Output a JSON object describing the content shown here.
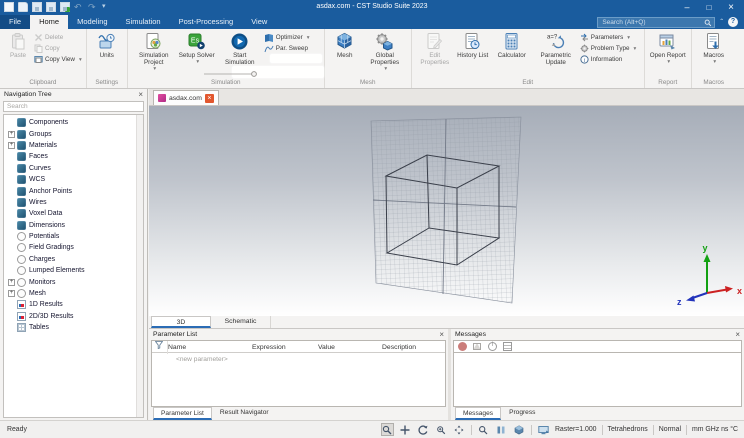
{
  "title_bar": {
    "title": "asdax.com - CST Studio Suite 2023",
    "search_placeholder": "Search (Alt+Q)"
  },
  "menu_tabs": [
    {
      "label": "File",
      "cls": "file"
    },
    {
      "label": "Home",
      "cls": "active"
    },
    {
      "label": "Modeling"
    },
    {
      "label": "Simulation"
    },
    {
      "label": "Post-Processing"
    },
    {
      "label": "View"
    }
  ],
  "ribbon": {
    "clipboard": {
      "label": "Clipboard",
      "paste": "Paste",
      "delete": "Delete",
      "copy": "Copy",
      "copy_view": "Copy View"
    },
    "settings": {
      "label": "Settings",
      "units": "Units"
    },
    "simulation": {
      "label": "Simulation",
      "simulation_project": "Simulation Project",
      "setup_solver": "Setup Solver",
      "start_simulation": "Start Simulation",
      "optimizer": "Optimizer",
      "par_sweep": "Par. Sweep"
    },
    "mesh": {
      "label": "Mesh",
      "mesh": "Mesh",
      "global_properties": "Global Properties"
    },
    "edit": {
      "label": "Edit",
      "edit_properties": "Edit Properties",
      "history_list": "History List",
      "calculator": "Calculator",
      "parametric_update": "Parametric Update",
      "parameters": "Parameters",
      "problem_type": "Problem Type",
      "information": "Information"
    },
    "report": {
      "label": "Report",
      "open_report": "Open Report"
    },
    "macros": {
      "label": "Macros",
      "macros": "Macros"
    }
  },
  "nav_tree": {
    "title": "Navigation Tree",
    "search_placeholder": "Search",
    "items": [
      {
        "label": "Components",
        "icon": "solid"
      },
      {
        "label": "Groups",
        "icon": "solid",
        "expand": "plus"
      },
      {
        "label": "Materials",
        "icon": "solid",
        "expand": "plus"
      },
      {
        "label": "Faces",
        "icon": "solid"
      },
      {
        "label": "Curves",
        "icon": "solid"
      },
      {
        "label": "WCS",
        "icon": "solid"
      },
      {
        "label": "Anchor Points",
        "icon": "solid"
      },
      {
        "label": "Wires",
        "icon": "solid"
      },
      {
        "label": "Voxel Data",
        "icon": "solid"
      },
      {
        "label": "Dimensions",
        "icon": "solid"
      },
      {
        "label": "Potentials",
        "icon": "ring"
      },
      {
        "label": "Field Gradings",
        "icon": "ring"
      },
      {
        "label": "Charges",
        "icon": "ring"
      },
      {
        "label": "Lumped Elements",
        "icon": "ring"
      },
      {
        "label": "Monitors",
        "icon": "ring",
        "expand": "plus"
      },
      {
        "label": "Mesh",
        "icon": "ring",
        "expand": "plus"
      },
      {
        "label": "1D Results",
        "icon": "chart"
      },
      {
        "label": "2D/3D Results",
        "icon": "chart"
      },
      {
        "label": "Tables",
        "icon": "table"
      }
    ]
  },
  "document": {
    "tab_label": "asdax.com"
  },
  "viewport": {
    "tabs": [
      {
        "label": "3D",
        "cls": "active"
      },
      {
        "label": "Schematic"
      }
    ],
    "axes": {
      "x": "x",
      "y": "y",
      "z": "z"
    }
  },
  "parameter_panel": {
    "title": "Parameter List",
    "columns": [
      "Name",
      "Expression",
      "Value",
      "Description"
    ],
    "new_row": "<new parameter>",
    "tabs": [
      {
        "label": "Parameter List",
        "cls": "active"
      },
      {
        "label": "Result Navigator"
      }
    ]
  },
  "messages_panel": {
    "title": "Messages",
    "tabs": [
      {
        "label": "Messages",
        "cls": "active"
      },
      {
        "label": "Progress"
      }
    ]
  },
  "status_bar": {
    "ready": "Ready",
    "raster": "Raster=1.000",
    "mesh_type": "Tetrahedrons",
    "render_mode": "Normal",
    "units": "mm GHz ns °C"
  },
  "icons": {
    "search": "magnifier",
    "help": "?",
    "minimize": "-",
    "maximize": "□",
    "close": "×",
    "dropdown_caret": "▾",
    "filter_funnel": "funnel",
    "message_filters": [
      "error-circle",
      "warning-triangle",
      "info-circle",
      "log-list"
    ]
  }
}
